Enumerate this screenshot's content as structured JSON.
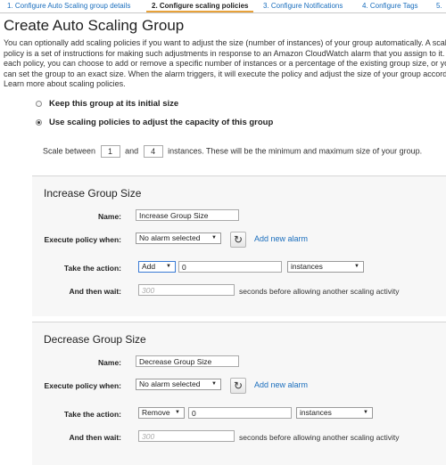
{
  "wizard": {
    "steps": [
      {
        "label": "1. Configure Auto Scaling group details"
      },
      {
        "label": "2. Configure scaling policies"
      },
      {
        "label": "3. Configure Notifications"
      },
      {
        "label": "4. Configure Tags"
      },
      {
        "label": "5."
      }
    ],
    "active_step": 1
  },
  "page_title": "Create Auto Scaling Group",
  "description": "You can optionally add scaling policies if you want to adjust the size (number of instances) of your group automatically. A scaling policy is a set of instructions for making such adjustments in response to an Amazon CloudWatch alarm that you assign to it. In each policy, you can choose to add or remove a specific number of instances or a percentage of the existing group size, or you can set the group to an exact size. When the alarm triggers, it will execute the policy and adjust the size of your group accordingly. Learn more about scaling policies.",
  "options": {
    "keep_initial": "Keep this group at its initial size",
    "use_policies": "Use scaling policies to adjust the capacity of this group",
    "selected": "use_policies"
  },
  "scale": {
    "prefix": "Scale between",
    "min": "1",
    "and": "and",
    "max": "4",
    "suffix": "instances. These will be the minimum and maximum size of your group."
  },
  "increase": {
    "heading": "Increase Group Size",
    "name_label": "Name:",
    "name_value": "Increase Group Size",
    "execute_label": "Execute policy when:",
    "alarm_value": "No alarm selected",
    "add_alarm": "Add new alarm",
    "action_label": "Take the action:",
    "action_value": "Add",
    "amount": "0",
    "unit": "instances",
    "wait_label": "And then wait:",
    "wait_placeholder": "300",
    "wait_note": "seconds before allowing another scaling activity"
  },
  "decrease": {
    "heading": "Decrease Group Size",
    "name_label": "Name:",
    "name_value": "Decrease Group Size",
    "execute_label": "Execute policy when:",
    "alarm_value": "No alarm selected",
    "add_alarm": "Add new alarm",
    "action_label": "Take the action:",
    "action_value": "Remove",
    "amount": "0",
    "unit": "instances",
    "wait_label": "And then wait:",
    "wait_placeholder": "300",
    "wait_note": "seconds before allowing another scaling activity"
  },
  "icons": {
    "refresh": "refresh-icon",
    "caret": "caret-down-icon",
    "radio": "radio-button-icon"
  },
  "colors": {
    "link": "#1a6ebd",
    "active_tab_underline": "#e8a23a",
    "panel_background": "#f7f7f7"
  }
}
